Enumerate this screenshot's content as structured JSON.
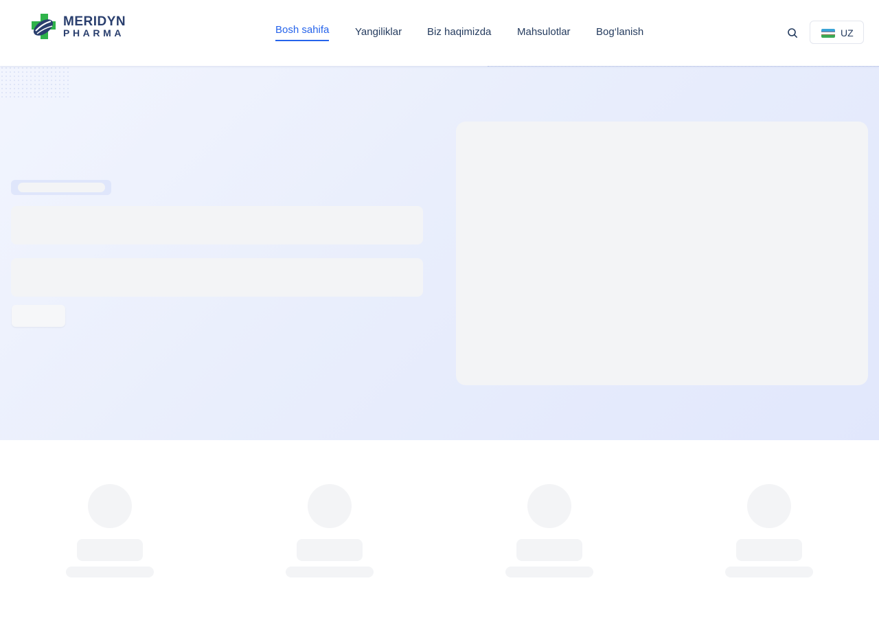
{
  "brand": {
    "name": "MERIDYN",
    "tagline": "PHARMA"
  },
  "nav": {
    "items": [
      {
        "label": "Bosh sahifa",
        "active": true
      },
      {
        "label": "Yangiliklar",
        "active": false
      },
      {
        "label": "Biz haqimizda",
        "active": false
      },
      {
        "label": "Mahsulotlar",
        "active": false
      },
      {
        "label": "Bog‘lanish",
        "active": false
      }
    ]
  },
  "header": {
    "search_icon": "search-icon"
  },
  "language": {
    "code": "UZ",
    "flag_icon": "uzbekistan-flag-icon"
  },
  "colors": {
    "accent": "#2563eb",
    "nav_text": "#243b5e",
    "logo_green": "#2fb34a",
    "logo_navy": "#2a3f6e",
    "skeleton": "#f3f4f6"
  },
  "loading_state": true
}
